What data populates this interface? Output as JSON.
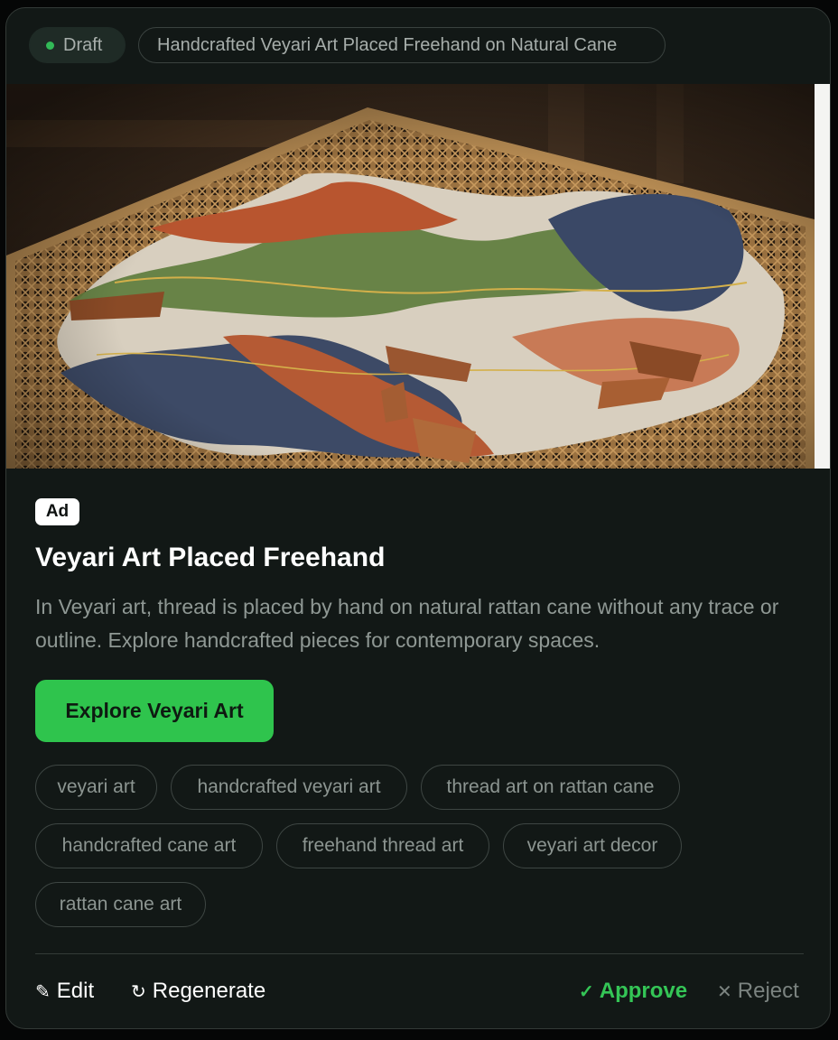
{
  "header": {
    "status_label": "Draft",
    "status_color": "#32b957",
    "title": "Handcrafted Veyari Art Placed Freehand on Natural Cane"
  },
  "ad": {
    "badge": "Ad",
    "headline": "Veyari Art Placed Freehand",
    "description": "In Veyari art, thread is placed by hand on natural rattan cane without any trace or outline. Explore handcrafted pieces for contemporary spaces.",
    "cta_label": "Explore Veyari Art",
    "cta_color": "#2fc44d"
  },
  "keywords": [
    "veyari art",
    "handcrafted veyari art",
    "thread art on rattan cane",
    "handcrafted cane art",
    "freehand thread art",
    "veyari art decor",
    "rattan cane art"
  ],
  "actions": {
    "edit": "Edit",
    "regenerate": "Regenerate",
    "approve": "Approve",
    "reject": "Reject"
  },
  "icons": {
    "edit": "pencil-icon",
    "regenerate": "refresh-icon",
    "approve": "check-icon",
    "reject": "close-icon"
  }
}
